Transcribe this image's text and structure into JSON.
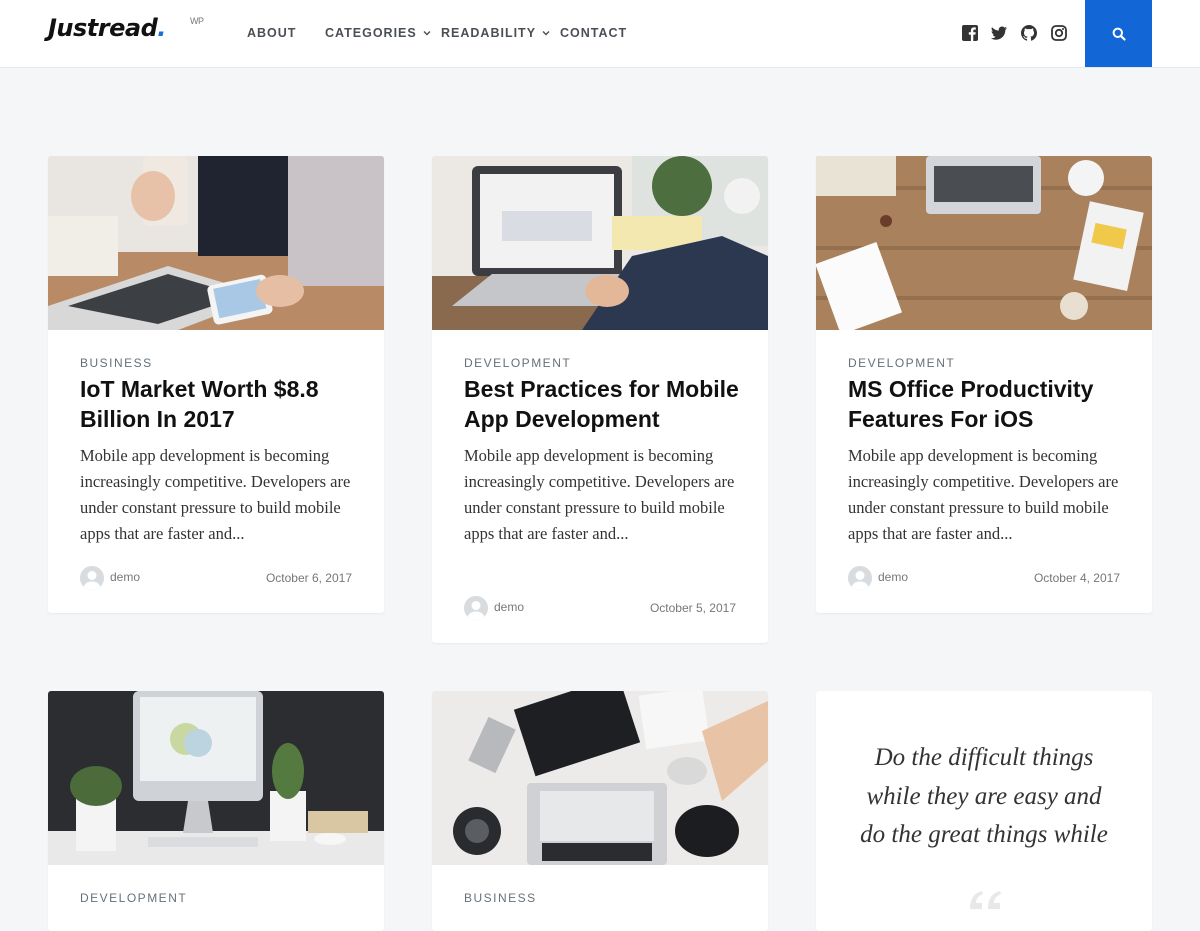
{
  "header": {
    "logo": {
      "text": "Justread",
      "dot": ".",
      "badge": "WP"
    },
    "nav": [
      {
        "label": "ABOUT"
      },
      {
        "label": "CATEGORIES"
      },
      {
        "label": "READABILITY"
      },
      {
        "label": "CONTACT"
      }
    ],
    "social_icons": [
      "facebook-icon",
      "twitter-icon",
      "github-icon",
      "instagram-icon"
    ],
    "search_icon": "search-icon",
    "accent_color": "#1366d6"
  },
  "posts": [
    {
      "category": "BUSINESS",
      "title": "IoT Market Worth $8.8 Billion In 2017",
      "excerpt": "Mobile app development is becoming increasingly competitive. Developers are under constant pressure to build mobile apps that are faster and...",
      "author": "demo",
      "date": "October 6, 2017"
    },
    {
      "category": "DEVELOPMENT",
      "title": "Best Practices for Mobile App Development",
      "excerpt": "Mobile app development is becoming increasingly competitive. Developers are under constant pressure to build mobile apps that are faster and...",
      "author": "demo",
      "date": "October 5, 2017"
    },
    {
      "category": "DEVELOPMENT",
      "title": "MS Office Productivity Features For iOS",
      "excerpt": "Mobile app development is becoming increasingly competitive. Developers are under constant pressure to build mobile apps that are faster and...",
      "author": "demo",
      "date": "October 4, 2017"
    },
    {
      "category": "DEVELOPMENT"
    },
    {
      "category": "BUSINESS"
    }
  ],
  "quote": {
    "text": "Do the difficult things while they are easy and do the great things while"
  }
}
